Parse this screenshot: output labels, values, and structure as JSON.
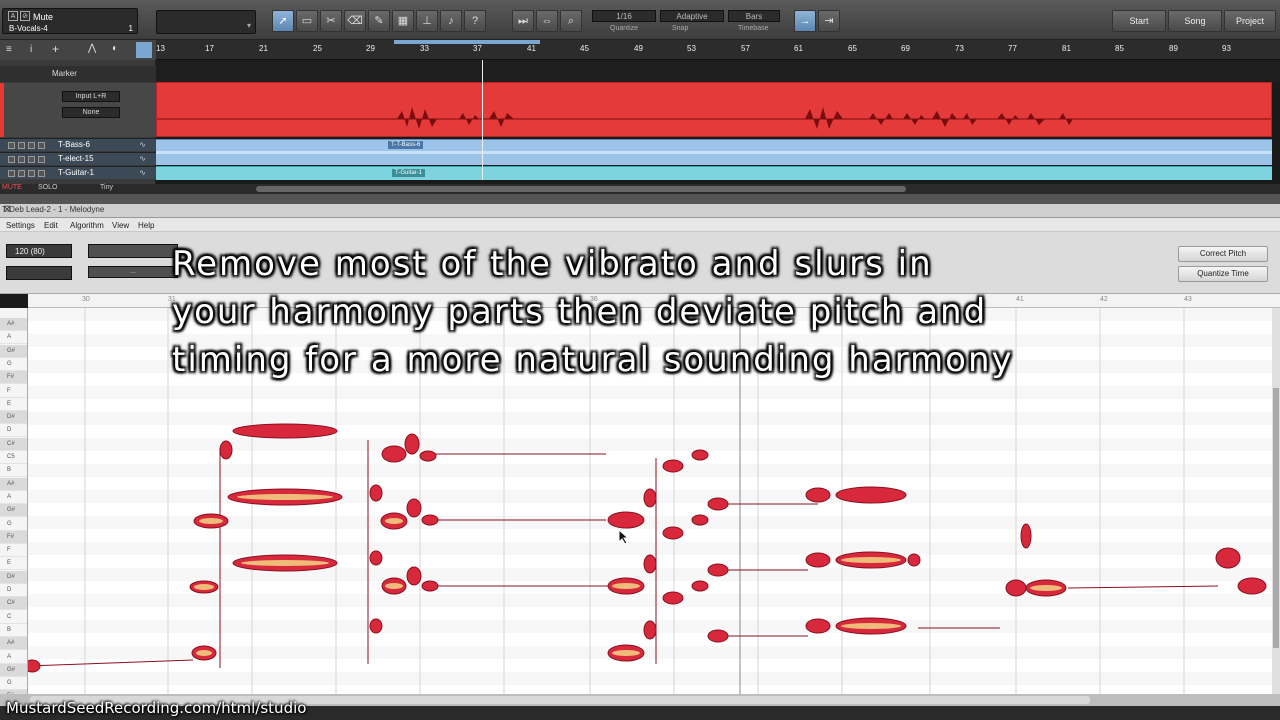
{
  "daw": {
    "track_selector": {
      "label": "Mute",
      "track_name": "B-Vocals-4",
      "number": "1"
    },
    "quantize": {
      "value": "1/16",
      "label": "Quantize"
    },
    "snap": {
      "value": "Adaptive",
      "label": "Snap"
    },
    "timebase": {
      "value": "Bars",
      "label": "Timebase"
    },
    "nav_buttons": [
      "Start",
      "Song",
      "Project"
    ],
    "ruler_ticks": [
      "13",
      "17",
      "21",
      "25",
      "29",
      "33",
      "37",
      "41",
      "45",
      "49",
      "53",
      "57",
      "61",
      "65",
      "69",
      "73",
      "77",
      "81",
      "85",
      "89",
      "93"
    ],
    "marker_label": "Marker",
    "vocal_track": {
      "input": "Input L+R",
      "output": "None"
    },
    "tracks": [
      "T-Bass-6",
      "T-elect-15",
      "T-Guitar-1"
    ],
    "event_labels": {
      "bass": "T-T-Bass-6",
      "guitar": "T-Guitar-1"
    },
    "status": {
      "mute": "MUTE",
      "solo": "SOLO",
      "size": "Tiny"
    }
  },
  "melodyne": {
    "window_title": "T-Deb Lead-2 - 1 - Melodyne",
    "menu": [
      "Settings",
      "Edit",
      "Algorithm",
      "View",
      "Help"
    ],
    "tempo": "120 (80)",
    "tool_sub": "...",
    "buttons": {
      "correct_pitch": "Correct Pitch",
      "quantize_time": "Quantize Time"
    },
    "ruler_marks": [
      "30",
      "31",
      "36",
      "41",
      "42",
      "43"
    ],
    "keys": [
      "A#",
      "A",
      "G#",
      "G",
      "F#",
      "F",
      "E",
      "D#",
      "D",
      "C#",
      "C5",
      "B",
      "A#",
      "A",
      "G#",
      "G",
      "F#",
      "F",
      "E",
      "D#",
      "D",
      "C#",
      "C",
      "B",
      "A#",
      "A",
      "G#",
      "G",
      "F#"
    ]
  },
  "overlay": {
    "caption_lines": [
      "Remove most of the vibrato and slurs in",
      "your harmony parts  then  deviate pitch and",
      "timing for a more natural sounding harmony"
    ],
    "watermark": "MustardSeedRecording.com/html/studio"
  },
  "colors": {
    "vocal_event": "#e53a3a",
    "blob_fill": "#d8283c",
    "blob_light": "#f5e08a",
    "accent": "#5c86b0"
  }
}
